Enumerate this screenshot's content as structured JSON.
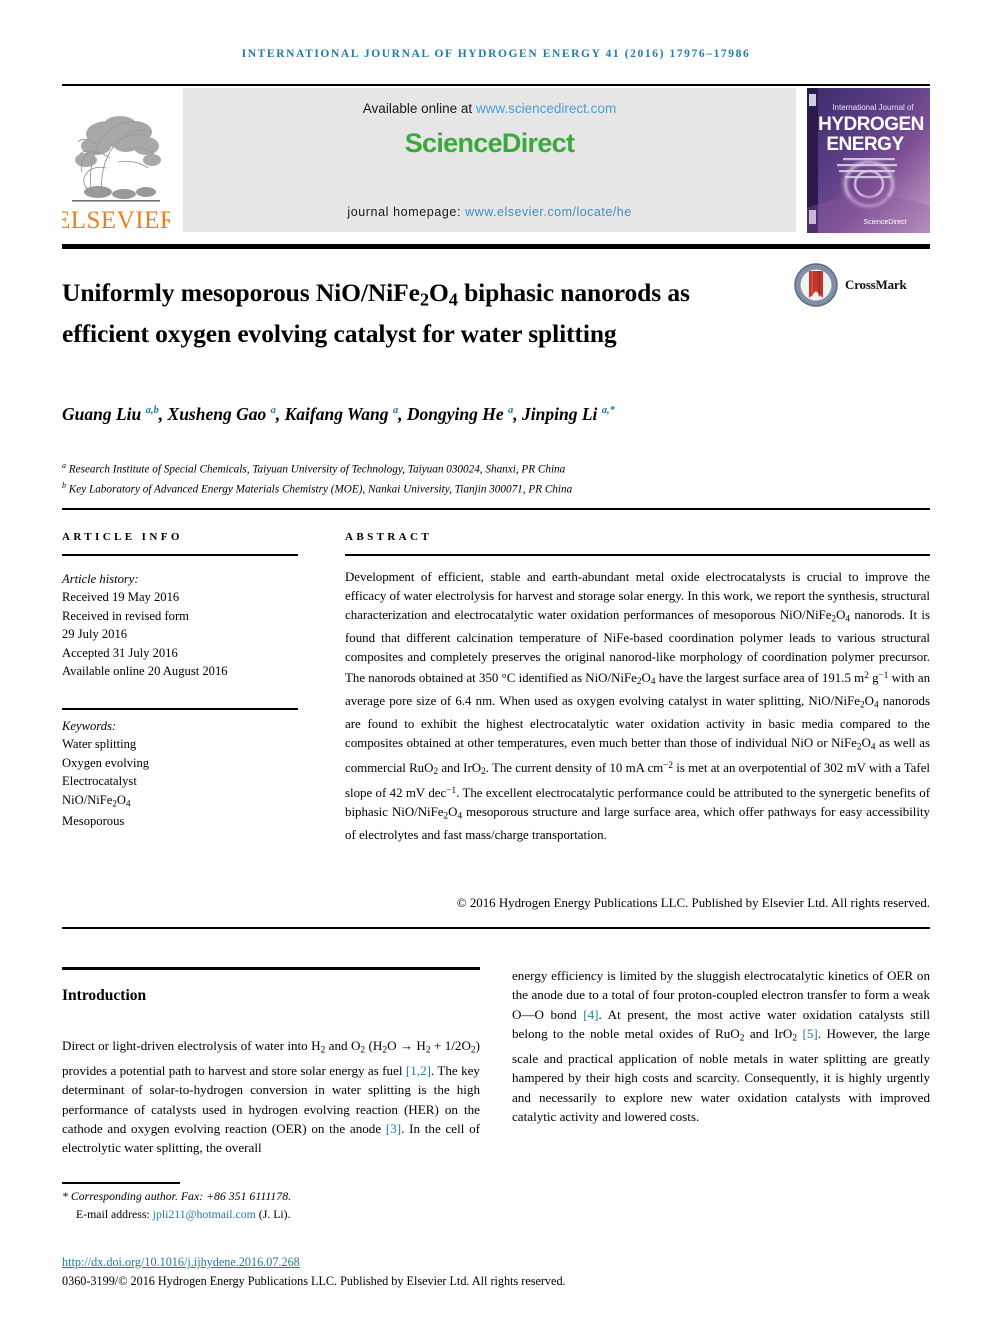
{
  "running_head": "INTERNATIONAL JOURNAL OF HYDROGEN ENERGY 41 (2016) 17976–17986",
  "masthead": {
    "publisher": "ELSEVIER",
    "available_prefix": "Available online at ",
    "available_link": "www.sciencedirect.com",
    "sciencedirect_logo": "ScienceDirect",
    "homepage_prefix": "journal homepage: ",
    "homepage_link": "www.elsevier.com/locate/he",
    "cover": {
      "line1": "International Journal of",
      "line2": "HYDROGEN",
      "line3": "ENERGY",
      "footer": "ScienceDirect"
    },
    "colors": {
      "elsevier_orange": "#F07D18",
      "sciencedirect_green": "#3BA93B",
      "link_blue": "#4A9FD4",
      "runhead_blue": "#1F7BA8",
      "banner_gray": "#E6E6E6"
    }
  },
  "article": {
    "title_html": "Uniformly mesoporous NiO/NiFe<sub>2</sub>O<sub>4</sub> biphasic nanorods as efficient oxygen evolving catalyst for water splitting",
    "crossmark_label": "CrossMark",
    "authors_html": "Guang Liu <sup>a,b</sup>, Xusheng Gao <sup>a</sup>, Kaifang Wang <sup>a</sup>, Dongying He <sup>a</sup>, Jinping Li <sup>a,*</sup>",
    "affiliations": [
      {
        "marker": "a",
        "text": "Research Institute of Special Chemicals, Taiyuan University of Technology, Taiyuan 030024, Shanxi, PR China"
      },
      {
        "marker": "b",
        "text": "Key Laboratory of Advanced Energy Materials Chemistry (MOE), Nankai University, Tianjin 300071, PR China"
      }
    ]
  },
  "article_info": {
    "heading": "ARTICLE INFO",
    "history_title": "Article history:",
    "history": [
      "Received 19 May 2016",
      "Received in revised form",
      "29 July 2016",
      "Accepted 31 July 2016",
      "Available online 20 August 2016"
    ],
    "keywords_title": "Keywords:",
    "keywords_html": [
      "Water splitting",
      "Oxygen evolving",
      "Electrocatalyst",
      "NiO/NiFe<sub>2</sub>O<sub>4</sub>",
      "Mesoporous"
    ]
  },
  "abstract": {
    "heading": "ABSTRACT",
    "body_html": "Development of efficient, stable and earth-abundant metal oxide electrocatalysts is crucial to improve the efficacy of water electrolysis for harvest and storage solar energy. In this work, we report the synthesis, structural characterization and electrocatalytic water oxidation performances of mesoporous NiO/NiFe<sub>2</sub>O<sub>4</sub> nanorods. It is found that different calcination temperature of NiFe-based coordination polymer leads to various structural composites and completely preserves the original nanorod-like morphology of coordination polymer precursor. The nanorods obtained at 350 &#176;C identified as NiO/NiFe<sub>2</sub>O<sub>4</sub> have the largest surface area of 191.5 m<sup class=\"num\">2</sup> g<sup class=\"num\">−1</sup> with an average pore size of 6.4 nm. When used as oxygen evolving catalyst in water splitting, NiO/NiFe<sub>2</sub>O<sub>4</sub> nanorods are found to exhibit the highest electrocatalytic water oxidation activity in basic media compared to the composites obtained at other temperatures, even much better than those of individual NiO or NiFe<sub>2</sub>O<sub>4</sub> as well as commercial RuO<sub>2</sub> and IrO<sub>2</sub>. The current density of 10 mA cm<sup class=\"num\">−2</sup> is met at an overpotential of 302 mV with a Tafel slope of 42 mV dec<sup class=\"num\">−1</sup>. The excellent electrocatalytic performance could be attributed to the synergetic benefits of biphasic NiO/NiFe<sub>2</sub>O<sub>4</sub> mesoporous structure and large surface area, which offer pathways for easy accessibility of electrolytes and fast mass/charge transportation.",
    "copyright": "© 2016 Hydrogen Energy Publications LLC. Published by Elsevier Ltd. All rights reserved."
  },
  "introduction": {
    "heading": "Introduction",
    "left_html": "Direct or light-driven electrolysis of water into H<sub>2</sub> and O<sub>2</sub> (H<sub>2</sub>O &#8594; H<sub>2</sub> + 1/2O<sub>2</sub>) provides a potential path to harvest and store solar energy as fuel <span class=\"ref\">[1,2]</span>. The key determinant of solar-to-hydrogen conversion in water splitting is the high performance of catalysts used in hydrogen evolving reaction (HER) on the cathode and oxygen evolving reaction (OER) on the anode <span class=\"ref\">[3]</span>. In the cell of electrolytic water splitting, the overall",
    "right_html": "energy efficiency is limited by the sluggish electrocatalytic kinetics of OER on the anode due to a total of four proton-coupled electron transfer to form a weak O&#8212;O bond <span class=\"ref\">[4]</span>. At present, the most active water oxidation catalysts still belong to the noble metal oxides of RuO<sub>2</sub> and IrO<sub>2</sub> <span class=\"ref\">[5]</span>. However, the large scale and practical application of noble metals in water splitting are greatly hampered by their high costs and scarcity. Consequently, it is highly urgently and necessarily to explore new water oxidation catalysts with improved catalytic activity and lowered costs."
  },
  "footer": {
    "corresponding_html": "<span class=\"fstar\">* Corresponding author. Fax: +86 351 6111178.</span>",
    "email_label": "E-mail address: ",
    "email": "jpli211@hotmail.com",
    "email_suffix": " (J. Li).",
    "doi": "http://dx.doi.org/10.1016/j.ijhydene.2016.07.268",
    "issn_line": "0360-3199/© 2016 Hydrogen Energy Publications LLC. Published by Elsevier Ltd. All rights reserved."
  }
}
